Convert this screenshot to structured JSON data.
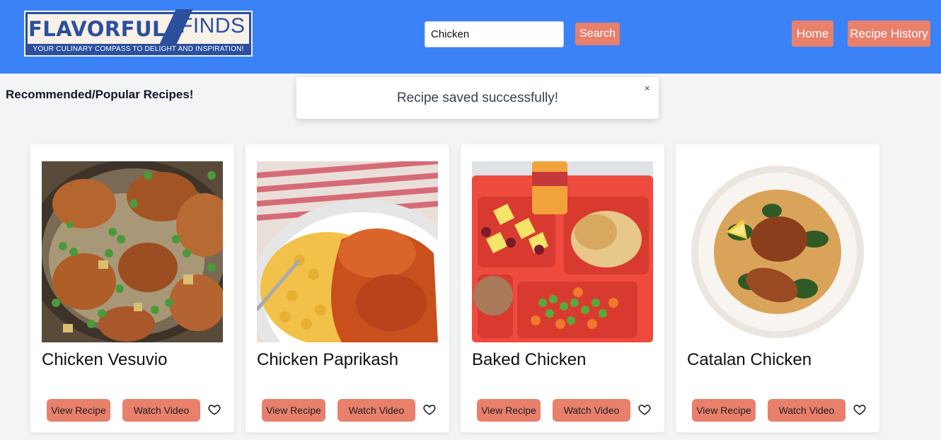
{
  "header": {
    "logo_left": "FLAVORFUL",
    "logo_right": "FINDS",
    "logo_tagline": "YOUR CULINARY COMPASS TO DELIGHT AND INSPIRATION!",
    "search_value": "Chicken",
    "search_label": "Search",
    "nav": {
      "home_label": "Home",
      "history_label": "Recipe History"
    }
  },
  "section_title": "Recommended/Popular Recipes!",
  "toast": {
    "message": "Recipe saved successfully!",
    "close": "×"
  },
  "cards": [
    {
      "title": "Chicken Vesuvio",
      "view_label": "View Recipe",
      "video_label": "Watch Video",
      "image": "chicken-vesuvio-photo"
    },
    {
      "title": "Chicken Paprikash",
      "view_label": "View Recipe",
      "video_label": "Watch Video",
      "image": "chicken-paprikash-photo"
    },
    {
      "title": "Baked Chicken",
      "view_label": "View Recipe",
      "video_label": "Watch Video",
      "image": "baked-chicken-tray-photo"
    },
    {
      "title": "Catalan Chicken",
      "view_label": "View Recipe",
      "video_label": "Watch Video",
      "image": "catalan-chicken-photo"
    }
  ],
  "colors": {
    "header_bg": "#3b82f6",
    "accent": "#e8806c",
    "page_bg": "#f3f4f6",
    "logo_blue": "#2c4f9e"
  }
}
